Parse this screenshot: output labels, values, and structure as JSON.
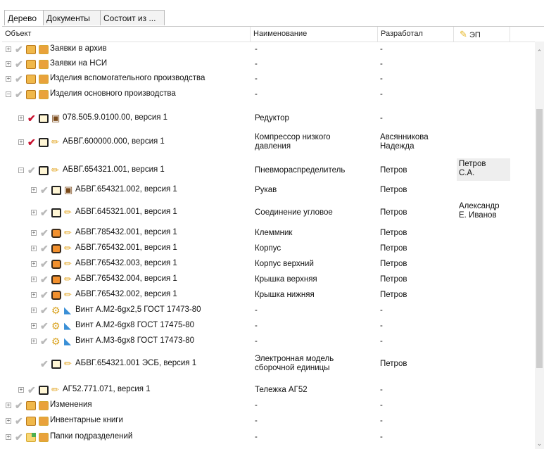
{
  "tabs": [
    {
      "label": "Дерево",
      "active": true
    },
    {
      "label": "Документы",
      "active": false
    },
    {
      "label": "Состоит из ...",
      "active": false
    }
  ],
  "columns": {
    "object": "Объект",
    "name": "Наименование",
    "developer": "Разработал",
    "signature": "ЭП"
  },
  "rows": [
    {
      "label": "Заявки в архив",
      "name": "-",
      "dev": "-",
      "sig": ""
    },
    {
      "label": "Заявки на НСИ",
      "name": "-",
      "dev": "-",
      "sig": ""
    },
    {
      "label": "Изделия вспомогательного производства",
      "name": "-",
      "dev": "-",
      "sig": ""
    },
    {
      "label": "Изделия основного производства",
      "name": "-",
      "dev": "-",
      "sig": ""
    },
    {
      "label": "078.505.9.0100.00, версия 1",
      "name": "Редуктор",
      "dev": "-",
      "sig": ""
    },
    {
      "label": "АБВГ.600000.000, версия 1",
      "name": "Компрессор низкого\nдавления",
      "dev": "Авсянникова\nНадежда",
      "sig": ""
    },
    {
      "label": "АБВГ.654321.001, версия 1",
      "name": "Пневмораспределитель",
      "dev": "Петров",
      "sig": "Петров\nС.А."
    },
    {
      "label": "АБВГ.654321.002, версия 1",
      "name": "Рукав",
      "dev": "Петров",
      "sig": ""
    },
    {
      "label": "АБВГ.645321.001, версия 1",
      "name": "Соединение угловое",
      "dev": "Петров",
      "sig": "Александр\nЕ. Иванов"
    },
    {
      "label": "АБВГ.785432.001, версия 1",
      "name": "Клеммник",
      "dev": "Петров",
      "sig": ""
    },
    {
      "label": "АБВГ.765432.001, версия 1",
      "name": "Корпус",
      "dev": "Петров",
      "sig": ""
    },
    {
      "label": "АБВГ.765432.003, версия 1",
      "name": "Корпус верхний",
      "dev": "Петров",
      "sig": ""
    },
    {
      "label": "АБВГ.765432.004, версия 1",
      "name": "Крышка верхняя",
      "dev": "Петров",
      "sig": ""
    },
    {
      "label": "АБВГ.765432.002, версия 1",
      "name": "Крышка нижняя",
      "dev": "Петров",
      "sig": ""
    },
    {
      "label": "Винт А.М2-6gx2,5 ГОСТ 17473-80",
      "name": "-",
      "dev": "-",
      "sig": ""
    },
    {
      "label": "Винт А.М2-6gx8 ГОСТ 17475-80",
      "name": "-",
      "dev": "-",
      "sig": ""
    },
    {
      "label": "Винт А.М3-6gx8 ГОСТ 17473-80",
      "name": "-",
      "dev": "-",
      "sig": ""
    },
    {
      "label": "АБВГ.654321.001 ЭСБ, версия 1",
      "name": "Электронная модель\nсборочной единицы",
      "dev": "Петров",
      "sig": ""
    },
    {
      "label": "АГ52.771.071, версия 1",
      "name": "Тележка АГ52",
      "dev": "-",
      "sig": ""
    },
    {
      "label": "Изменения",
      "name": "-",
      "dev": "-",
      "sig": ""
    },
    {
      "label": "Инвентарные книги",
      "name": "-",
      "dev": "-",
      "sig": ""
    },
    {
      "label": "Папки подразделений",
      "name": "-",
      "dev": "-",
      "sig": ""
    }
  ]
}
